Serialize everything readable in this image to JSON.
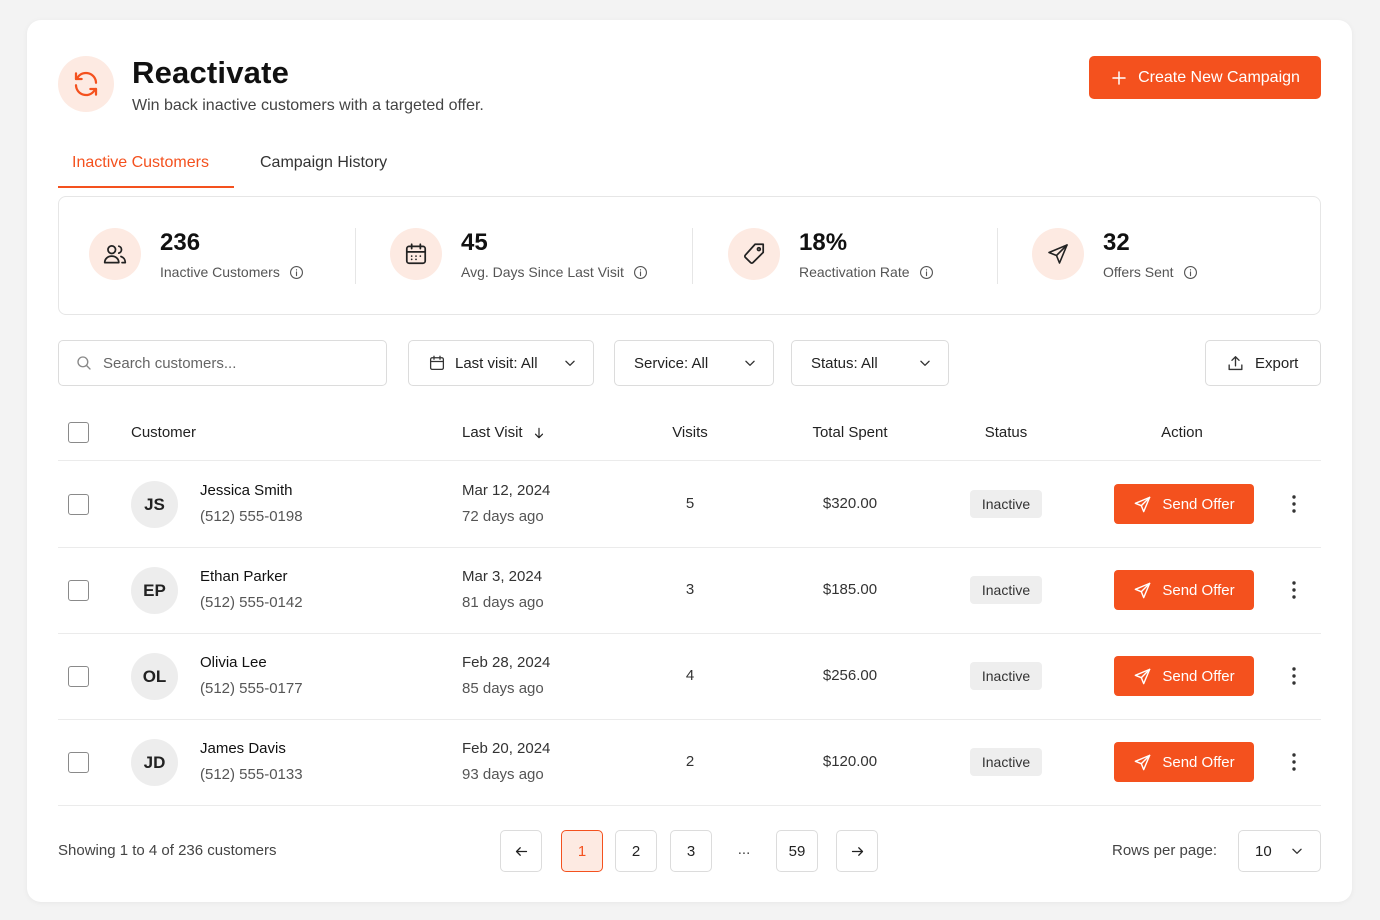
{
  "header": {
    "title": "Reactivate",
    "subtitle": "Win back inactive customers with a targeted offer.",
    "icon": "refresh-icon",
    "create_button_label": "Create New Campaign"
  },
  "tabs": [
    {
      "label": "Inactive Customers",
      "active": true
    },
    {
      "label": "Campaign History",
      "active": false
    }
  ],
  "stats": [
    {
      "value": "236",
      "label": "Inactive Customers",
      "icon": "users-icon"
    },
    {
      "value": "45",
      "label": "Avg. Days Since Last Visit",
      "icon": "calendar-icon"
    },
    {
      "value": "18%",
      "label": "Reactivation Rate",
      "icon": "tag-icon"
    },
    {
      "value": "32",
      "label": "Offers Sent",
      "icon": "send-icon"
    }
  ],
  "filters": {
    "search_placeholder": "Search customers...",
    "last_visit": "Last visit: All",
    "service": "Service: All",
    "status": "Status: All",
    "export_label": "Export"
  },
  "table": {
    "headers": {
      "customer": "Customer",
      "last_visit": "Last Visit",
      "visits": "Visits",
      "total_spent": "Total Spent",
      "status": "Status",
      "action": "Action"
    },
    "rows": [
      {
        "initials": "JS",
        "name": "Jessica Smith",
        "phone": "(512) 555-0198",
        "last_visit_date": "Mar 12, 2024",
        "last_visit_ago": "72 days ago",
        "visits": "5",
        "total_spent": "$320.00",
        "status": "Inactive",
        "action_label": "Send Offer"
      },
      {
        "initials": "EP",
        "name": "Ethan Parker",
        "phone": "(512) 555-0142",
        "last_visit_date": "Mar 3, 2024",
        "last_visit_ago": "81 days ago",
        "visits": "3",
        "total_spent": "$185.00",
        "status": "Inactive",
        "action_label": "Send Offer"
      },
      {
        "initials": "OL",
        "name": "Olivia Lee",
        "phone": "(512) 555-0177",
        "last_visit_date": "Feb 28, 2024",
        "last_visit_ago": "85 days ago",
        "visits": "4",
        "total_spent": "$256.00",
        "status": "Inactive",
        "action_label": "Send Offer"
      },
      {
        "initials": "JD",
        "name": "James Davis",
        "phone": "(512) 555-0133",
        "last_visit_date": "Feb 20, 2024",
        "last_visit_ago": "93 days ago",
        "visits": "2",
        "total_spent": "$120.00",
        "status": "Inactive",
        "action_label": "Send Offer"
      }
    ]
  },
  "pagination": {
    "showing_text": "Showing 1 to 4 of 236 customers",
    "pages": [
      "1",
      "2",
      "3",
      "59"
    ],
    "current_page": "1",
    "ellipsis": "...",
    "rows_per_page_label": "Rows per page:",
    "rows_per_page": "10"
  },
  "colors": {
    "accent": "#f4511e",
    "accent_light": "#fdeae2",
    "badge_bg": "#eeeeee",
    "border": "#dcdcdc"
  }
}
